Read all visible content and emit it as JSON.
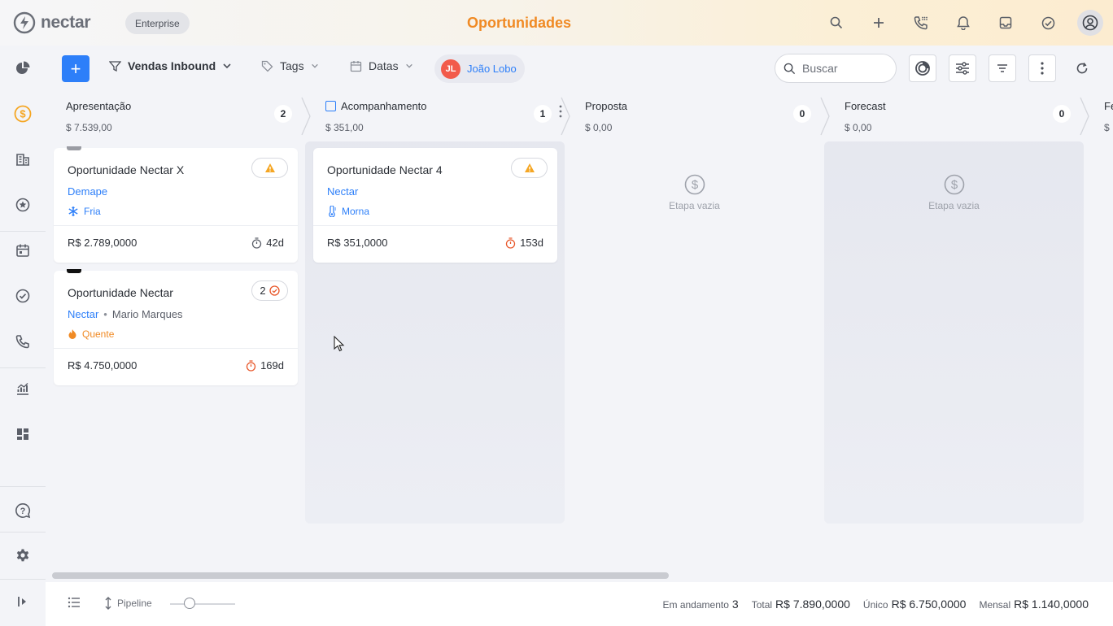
{
  "app": {
    "logo_text": "nectar",
    "plan_badge": "Enterprise",
    "page_title": "Oportunidades",
    "accent_color": "#f08a24",
    "primary_color": "#2d7ff9"
  },
  "top_icons": [
    "search-icon",
    "plus-icon",
    "phone-icon",
    "bell-icon",
    "inbox-icon",
    "check-circle-icon",
    "user-circle-icon"
  ],
  "sidebar": {
    "items": [
      {
        "icon": "pie-chart-icon"
      },
      {
        "icon": "dollar-icon",
        "active": true
      },
      {
        "icon": "building-icon"
      },
      {
        "icon": "star-icon"
      },
      {
        "icon": "calendar-icon"
      },
      {
        "icon": "check-circle-icon"
      },
      {
        "icon": "phone-icon"
      },
      {
        "icon": "analytics-icon"
      },
      {
        "icon": "dashboard-icon"
      },
      {
        "icon": "help-icon"
      },
      {
        "icon": "settings-icon"
      },
      {
        "icon": "expand-icon"
      }
    ]
  },
  "toolbar": {
    "add_label": "+",
    "pipeline_filter": "Vendas Inbound",
    "tags_label": "Tags",
    "dates_label": "Datas",
    "user_initials": "JL",
    "user_name": "João Lobo",
    "search_placeholder": "Buscar"
  },
  "stages": [
    {
      "name": "Apresentação",
      "total": "$ 7.539,00",
      "count": "2"
    },
    {
      "name": "Acompanhamento",
      "total": "$ 351,00",
      "count": "1"
    },
    {
      "name": "Proposta",
      "total": "$ 0,00",
      "count": "0",
      "empty_label": "Etapa vazia"
    },
    {
      "name": "Forecast",
      "total": "$ 0,00",
      "count": "0",
      "empty_label": "Etapa vazia"
    },
    {
      "name": "Fe",
      "total": "$"
    }
  ],
  "cards": [
    {
      "stage": 0,
      "title": "Oportunidade Nectar X",
      "company": "Demape",
      "temperature": "Fria",
      "value": "R$ 2.789,0000",
      "age": "42d",
      "flag_color": "#9a9ca3",
      "alert": "warning",
      "temp_color": "#2d7ff9",
      "age_color": "#5b5f69"
    },
    {
      "stage": 0,
      "title": "Oportunidade Nectar",
      "company": "Nectar",
      "contact": "Mario Marques",
      "temperature": "Quente",
      "value": "R$ 4.750,0000",
      "age": "169d",
      "flag_color": "#111111",
      "alert_count": "2",
      "temp_color": "#f08a24",
      "age_color": "#e8572a"
    },
    {
      "stage": 1,
      "title": "Oportunidade Nectar 4",
      "company": "Nectar",
      "temperature": "Morna",
      "value": "R$ 351,0000",
      "age": "153d",
      "alert": "warning",
      "temp_color": "#2d7ff9",
      "age_color": "#e8572a"
    }
  ],
  "footer": {
    "view_label": "Pipeline",
    "in_progress_label": "Em andamento",
    "in_progress_value": "3",
    "total_label": "Total",
    "total_value": "R$ 7.890,0000",
    "unique_label": "Único",
    "unique_value": "R$ 6.750,0000",
    "monthly_label": "Mensal",
    "monthly_value": "R$ 1.140,0000"
  }
}
